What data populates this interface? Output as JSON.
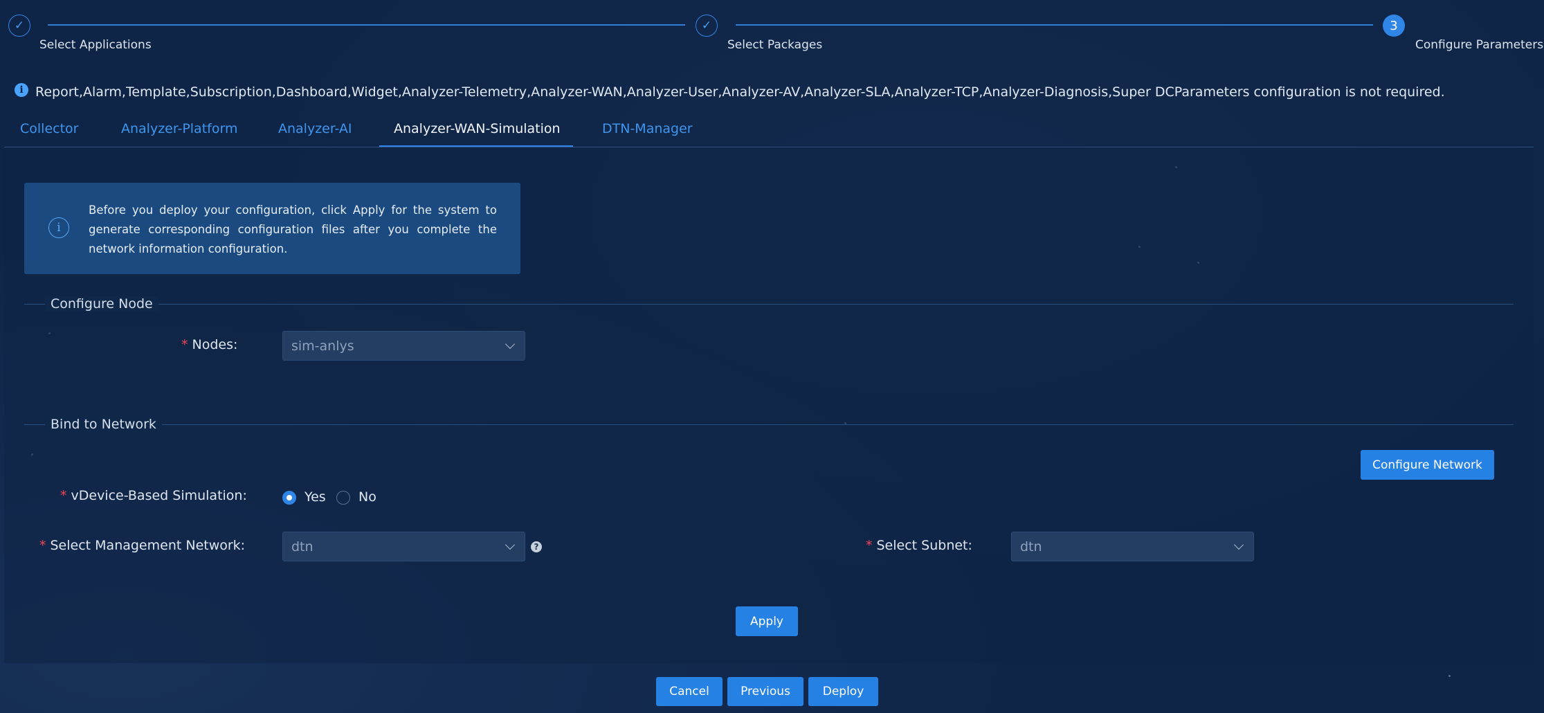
{
  "stepper": {
    "steps": [
      {
        "label": "Select Applications",
        "state": "done",
        "marker": "✓"
      },
      {
        "label": "Select Packages",
        "state": "done",
        "marker": "✓"
      },
      {
        "label": "Configure Parameters",
        "state": "current",
        "marker": "3"
      }
    ]
  },
  "notice": {
    "icon": "info-icon",
    "text": "Report,Alarm,Template,Subscription,Dashboard,Widget,Analyzer-Telemetry,Analyzer-WAN,Analyzer-User,Analyzer-AV,Analyzer-SLA,Analyzer-TCP,Analyzer-Diagnosis,Super DCParameters configuration is not required."
  },
  "tabs": [
    {
      "label": "Collector",
      "active": false
    },
    {
      "label": "Analyzer-Platform",
      "active": false
    },
    {
      "label": "Analyzer-AI",
      "active": false
    },
    {
      "label": "Analyzer-WAN-Simulation",
      "active": true
    },
    {
      "label": "DTN-Manager",
      "active": false
    }
  ],
  "info_box": {
    "icon": "info-circle-icon",
    "text": "Before you deploy your configuration, click Apply for the system to generate corresponding configuration files after you complete the network information configuration."
  },
  "configure_node": {
    "title": "Configure Node",
    "nodes_label": "Nodes:",
    "nodes_value": "sim-anlys"
  },
  "bind_network": {
    "title": "Bind to Network",
    "configure_network_label": "Configure Network",
    "vdevice_label": "vDevice-Based Simulation:",
    "vdevice_options": [
      "Yes",
      "No"
    ],
    "vdevice_selected": "Yes",
    "mgmt_network_label": "Select Management Network:",
    "mgmt_network_value": "dtn",
    "subnet_label": "Select Subnet:",
    "subnet_value": "dtn",
    "help_glyph": "?"
  },
  "required_marker": "*",
  "apply_label": "Apply",
  "footer": {
    "cancel_label": "Cancel",
    "previous_label": "Previous",
    "deploy_label": "Deploy"
  },
  "colors": {
    "background": "#0f2547",
    "accent": "#2f86e6",
    "tab_link": "#3f96ee",
    "required": "#f0465a",
    "info_box": "#1a4a7f"
  }
}
